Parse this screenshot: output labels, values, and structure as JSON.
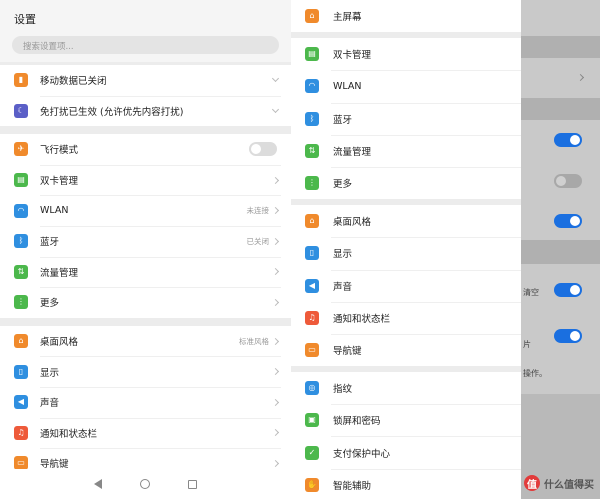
{
  "left": {
    "title": "设置",
    "search_placeholder": "搜索设置项...",
    "group1": [
      {
        "label": "移动数据已关闭",
        "icon": "mobile-data-icon",
        "color": "#f08a2c"
      },
      {
        "label": "免打扰已生效 (允许优先内容打扰)",
        "icon": "moon-icon",
        "color": "#5b5fc7"
      }
    ],
    "group2": [
      {
        "label": "飞行模式",
        "icon": "airplane-icon",
        "color": "#f08a2c"
      },
      {
        "label": "双卡管理",
        "icon": "sim-card-icon",
        "color": "#4cb84c"
      },
      {
        "label": "WLAN",
        "value": "未连接",
        "icon": "wifi-icon",
        "color": "#2f8fe0"
      },
      {
        "label": "蓝牙",
        "value": "已关闭",
        "icon": "bluetooth-icon",
        "color": "#2f8fe0"
      },
      {
        "label": "流量管理",
        "icon": "data-usage-icon",
        "color": "#4cb84c"
      },
      {
        "label": "更多",
        "icon": "more-icon",
        "color": "#4cb84c"
      }
    ],
    "group3": [
      {
        "label": "桌面风格",
        "value": "标准风格",
        "icon": "home-style-icon",
        "color": "#f08a2c"
      },
      {
        "label": "显示",
        "icon": "display-icon",
        "color": "#2f8fe0"
      },
      {
        "label": "声音",
        "icon": "sound-icon",
        "color": "#2f8fe0"
      },
      {
        "label": "通知和状态栏",
        "icon": "notification-icon",
        "color": "#ee5a3a"
      },
      {
        "label": "导航键",
        "icon": "navigation-keys-icon",
        "color": "#f08a2c"
      }
    ]
  },
  "menu": {
    "groups": [
      [
        {
          "label": "主屏幕",
          "icon": "home-screen-icon",
          "color": "#f08a2c"
        }
      ],
      [
        {
          "label": "双卡管理",
          "icon": "sim-card-icon",
          "color": "#4cb84c"
        },
        {
          "label": "WLAN",
          "icon": "wifi-icon",
          "color": "#2f8fe0"
        },
        {
          "label": "蓝牙",
          "icon": "bluetooth-icon",
          "color": "#2f8fe0"
        },
        {
          "label": "流量管理",
          "icon": "data-usage-icon",
          "color": "#4cb84c"
        },
        {
          "label": "更多",
          "icon": "more-icon",
          "color": "#4cb84c"
        }
      ],
      [
        {
          "label": "桌面风格",
          "icon": "home-style-icon",
          "color": "#f08a2c"
        },
        {
          "label": "显示",
          "icon": "display-icon",
          "color": "#2f8fe0"
        },
        {
          "label": "声音",
          "icon": "sound-icon",
          "color": "#2f8fe0"
        },
        {
          "label": "通知和状态栏",
          "icon": "notification-icon",
          "color": "#ee5a3a"
        },
        {
          "label": "导航键",
          "icon": "navigation-keys-icon",
          "color": "#f08a2c"
        }
      ],
      [
        {
          "label": "指纹",
          "icon": "fingerprint-icon",
          "color": "#2f8fe0"
        },
        {
          "label": "锁屏和密码",
          "icon": "lock-icon",
          "color": "#4cb84c"
        },
        {
          "label": "支付保护中心",
          "icon": "shield-icon",
          "color": "#4cb84c"
        },
        {
          "label": "智能辅助",
          "icon": "hand-icon",
          "color": "#f08a2c"
        }
      ]
    ]
  },
  "background": {
    "text1": "清空",
    "text2": "片",
    "text3": "操作。"
  },
  "watermark": {
    "badge": "值",
    "text": "什么值得买"
  }
}
